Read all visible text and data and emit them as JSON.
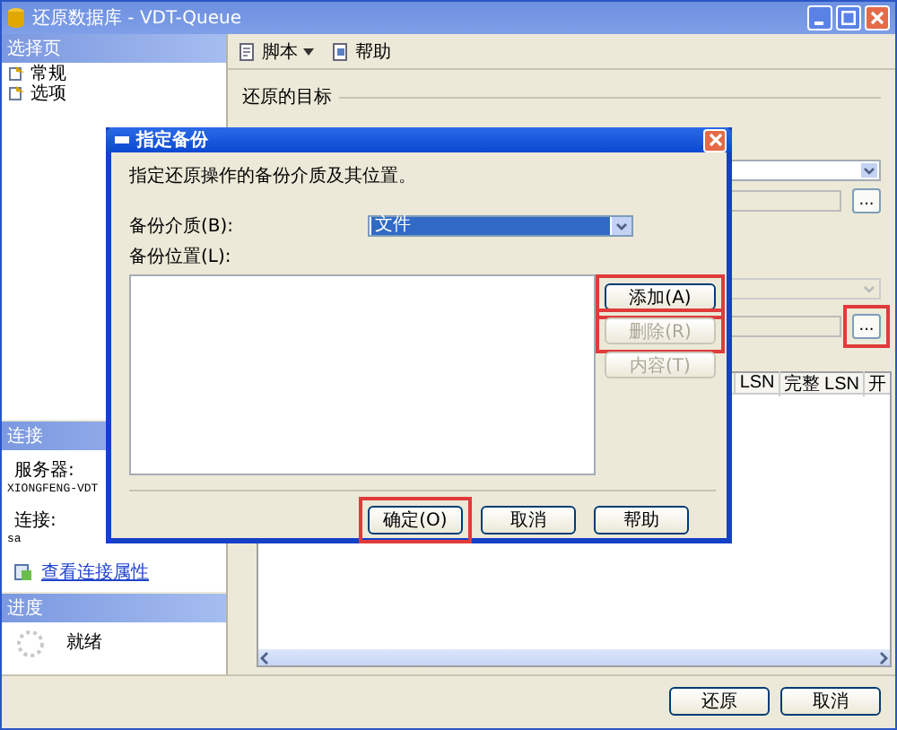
{
  "window": {
    "title": "还原数据库 - VDT-Queue"
  },
  "sidebar": {
    "header": "选择页",
    "items": [
      {
        "label": "常规"
      },
      {
        "label": "选项"
      }
    ]
  },
  "connection": {
    "header": "连接",
    "server_label": "服务器:",
    "server": "XIONGFENG-VDT",
    "login_label": "连接:",
    "login": "sa",
    "link": "查看连接属性"
  },
  "progress": {
    "header": "进度",
    "status": "就绪"
  },
  "toolbar": [
    {
      "label": "脚本",
      "kind": "script",
      "dropdown": true
    },
    {
      "label": "帮助",
      "kind": "help",
      "dropdown": false
    }
  ],
  "restore_target": {
    "group_label": "还原的目标",
    "browse_buttons": [
      {
        "label": "...",
        "highlighted": false
      },
      {
        "label": "...",
        "highlighted": true
      }
    ]
  },
  "table": {
    "columns": [
      "LSN",
      "完整 LSN",
      "开"
    ]
  },
  "buttons": [
    {
      "label": "还原"
    },
    {
      "label": "取消"
    }
  ],
  "dialog": {
    "title": "指定备份",
    "instruction": "指定还原操作的备份介质及其位置。",
    "media_label": "备份介质(B):",
    "media_value": "文件",
    "location_label": "备份位置(L):",
    "side_buttons": [
      {
        "label": "添加(A)",
        "disabled": false,
        "highlighted": true
      },
      {
        "label": "删除(R)",
        "disabled": true,
        "highlighted": true
      },
      {
        "label": "内容(T)",
        "disabled": true,
        "highlighted": false
      }
    ],
    "buttons": [
      {
        "label": "确定(O)",
        "highlighted": true
      },
      {
        "label": "取消",
        "highlighted": false
      },
      {
        "label": "帮助",
        "highlighted": false
      }
    ]
  }
}
